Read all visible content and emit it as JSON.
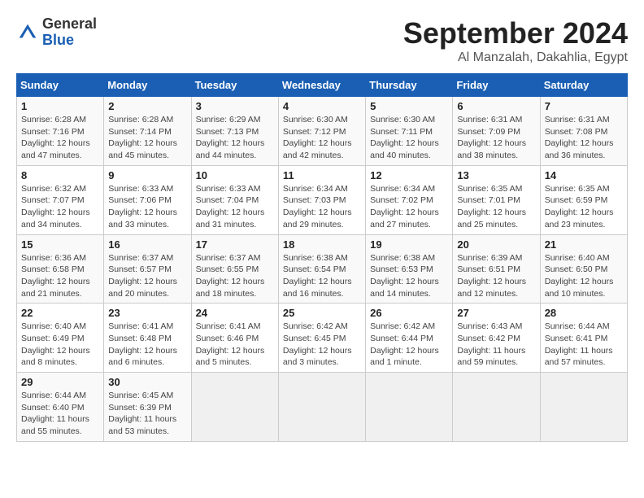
{
  "header": {
    "logo_general": "General",
    "logo_blue": "Blue",
    "month": "September 2024",
    "location": "Al Manzalah, Dakahlia, Egypt"
  },
  "weekdays": [
    "Sunday",
    "Monday",
    "Tuesday",
    "Wednesday",
    "Thursday",
    "Friday",
    "Saturday"
  ],
  "weeks": [
    [
      {
        "day": "1",
        "sunrise": "6:28 AM",
        "sunset": "7:16 PM",
        "daylight": "12 hours and 47 minutes."
      },
      {
        "day": "2",
        "sunrise": "6:28 AM",
        "sunset": "7:14 PM",
        "daylight": "12 hours and 45 minutes."
      },
      {
        "day": "3",
        "sunrise": "6:29 AM",
        "sunset": "7:13 PM",
        "daylight": "12 hours and 44 minutes."
      },
      {
        "day": "4",
        "sunrise": "6:30 AM",
        "sunset": "7:12 PM",
        "daylight": "12 hours and 42 minutes."
      },
      {
        "day": "5",
        "sunrise": "6:30 AM",
        "sunset": "7:11 PM",
        "daylight": "12 hours and 40 minutes."
      },
      {
        "day": "6",
        "sunrise": "6:31 AM",
        "sunset": "7:09 PM",
        "daylight": "12 hours and 38 minutes."
      },
      {
        "day": "7",
        "sunrise": "6:31 AM",
        "sunset": "7:08 PM",
        "daylight": "12 hours and 36 minutes."
      }
    ],
    [
      {
        "day": "8",
        "sunrise": "6:32 AM",
        "sunset": "7:07 PM",
        "daylight": "12 hours and 34 minutes."
      },
      {
        "day": "9",
        "sunrise": "6:33 AM",
        "sunset": "7:06 PM",
        "daylight": "12 hours and 33 minutes."
      },
      {
        "day": "10",
        "sunrise": "6:33 AM",
        "sunset": "7:04 PM",
        "daylight": "12 hours and 31 minutes."
      },
      {
        "day": "11",
        "sunrise": "6:34 AM",
        "sunset": "7:03 PM",
        "daylight": "12 hours and 29 minutes."
      },
      {
        "day": "12",
        "sunrise": "6:34 AM",
        "sunset": "7:02 PM",
        "daylight": "12 hours and 27 minutes."
      },
      {
        "day": "13",
        "sunrise": "6:35 AM",
        "sunset": "7:01 PM",
        "daylight": "12 hours and 25 minutes."
      },
      {
        "day": "14",
        "sunrise": "6:35 AM",
        "sunset": "6:59 PM",
        "daylight": "12 hours and 23 minutes."
      }
    ],
    [
      {
        "day": "15",
        "sunrise": "6:36 AM",
        "sunset": "6:58 PM",
        "daylight": "12 hours and 21 minutes."
      },
      {
        "day": "16",
        "sunrise": "6:37 AM",
        "sunset": "6:57 PM",
        "daylight": "12 hours and 20 minutes."
      },
      {
        "day": "17",
        "sunrise": "6:37 AM",
        "sunset": "6:55 PM",
        "daylight": "12 hours and 18 minutes."
      },
      {
        "day": "18",
        "sunrise": "6:38 AM",
        "sunset": "6:54 PM",
        "daylight": "12 hours and 16 minutes."
      },
      {
        "day": "19",
        "sunrise": "6:38 AM",
        "sunset": "6:53 PM",
        "daylight": "12 hours and 14 minutes."
      },
      {
        "day": "20",
        "sunrise": "6:39 AM",
        "sunset": "6:51 PM",
        "daylight": "12 hours and 12 minutes."
      },
      {
        "day": "21",
        "sunrise": "6:40 AM",
        "sunset": "6:50 PM",
        "daylight": "12 hours and 10 minutes."
      }
    ],
    [
      {
        "day": "22",
        "sunrise": "6:40 AM",
        "sunset": "6:49 PM",
        "daylight": "12 hours and 8 minutes."
      },
      {
        "day": "23",
        "sunrise": "6:41 AM",
        "sunset": "6:48 PM",
        "daylight": "12 hours and 6 minutes."
      },
      {
        "day": "24",
        "sunrise": "6:41 AM",
        "sunset": "6:46 PM",
        "daylight": "12 hours and 5 minutes."
      },
      {
        "day": "25",
        "sunrise": "6:42 AM",
        "sunset": "6:45 PM",
        "daylight": "12 hours and 3 minutes."
      },
      {
        "day": "26",
        "sunrise": "6:42 AM",
        "sunset": "6:44 PM",
        "daylight": "12 hours and 1 minute."
      },
      {
        "day": "27",
        "sunrise": "6:43 AM",
        "sunset": "6:42 PM",
        "daylight": "11 hours and 59 minutes."
      },
      {
        "day": "28",
        "sunrise": "6:44 AM",
        "sunset": "6:41 PM",
        "daylight": "11 hours and 57 minutes."
      }
    ],
    [
      {
        "day": "29",
        "sunrise": "6:44 AM",
        "sunset": "6:40 PM",
        "daylight": "11 hours and 55 minutes."
      },
      {
        "day": "30",
        "sunrise": "6:45 AM",
        "sunset": "6:39 PM",
        "daylight": "11 hours and 53 minutes."
      },
      null,
      null,
      null,
      null,
      null
    ]
  ]
}
